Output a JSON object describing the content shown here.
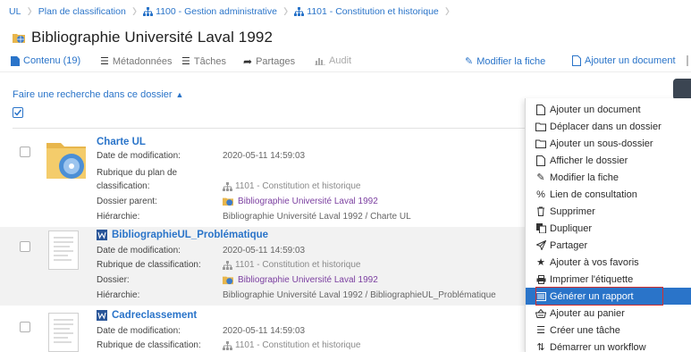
{
  "breadcrumb": {
    "items": [
      {
        "label": "UL"
      },
      {
        "label": "Plan de classification"
      },
      {
        "label": "1100 - Gestion administrative",
        "icon": "tree-icon"
      },
      {
        "label": "1101 - Constitution et historique",
        "icon": "tree-icon"
      }
    ]
  },
  "page": {
    "title": "Bibliographie Université Laval 1992",
    "title_icon": "folder-globe-icon"
  },
  "tabs": [
    {
      "label": "Contenu (19)",
      "icon": "file-icon",
      "state": "active"
    },
    {
      "label": "Métadonnées",
      "icon": "list-icon",
      "state": "normal"
    },
    {
      "label": "Tâches",
      "icon": "tasks-icon",
      "state": "normal"
    },
    {
      "label": "Partages",
      "icon": "share-icon",
      "state": "normal"
    },
    {
      "label": "Audit",
      "icon": "chart-icon",
      "state": "disabled"
    }
  ],
  "actions": {
    "edit": "Modifier la fiche",
    "add_document": "Ajouter un document"
  },
  "search": {
    "toggle_label": "Faire une recherche dans ce dossier"
  },
  "rows": [
    {
      "title": "Charte UL",
      "kind": "folder",
      "fields": [
        {
          "label": "Date de modification:",
          "value": "2020-05-11 14:59:03"
        },
        {
          "label": "Rubrique du plan de",
          "value": ""
        },
        {
          "label": "classification:",
          "value": "1101 - Constitution et historique"
        },
        {
          "label": "Dossier parent:",
          "value": "Bibliographie Université Laval 1992"
        },
        {
          "label": "Hiérarchie:",
          "value": "Bibliographie Université Laval 1992 / Charte UL"
        }
      ]
    },
    {
      "title": "BibliographieUL_Problématique",
      "kind": "document",
      "fields": [
        {
          "label": "Date de modification:",
          "value": "2020-05-11 14:59:03"
        },
        {
          "label": "Rubrique de classification:",
          "value": "1101 - Constitution et historique"
        },
        {
          "label": "Dossier:",
          "value": "Bibliographie Université Laval 1992"
        },
        {
          "label": "Hiérarchie:",
          "value": "Bibliographie Université Laval 1992 / BibliographieUL_Problématique"
        }
      ]
    },
    {
      "title": "Cadreclassement",
      "kind": "document",
      "fields": [
        {
          "label": "Date de modification:",
          "value": "2020-05-11 14:59:03"
        },
        {
          "label": "Rubrique de classification:",
          "value": "1101 - Constitution et historique"
        }
      ]
    }
  ],
  "context_menu": {
    "items": [
      {
        "label": "Ajouter un document",
        "icon": "file-icon"
      },
      {
        "label": "Déplacer dans un dossier",
        "icon": "folder-icon"
      },
      {
        "label": "Ajouter un sous-dossier",
        "icon": "folder-icon"
      },
      {
        "label": "Afficher le dossier",
        "icon": "file-icon"
      },
      {
        "label": "Modifier la fiche",
        "icon": "edit-icon"
      },
      {
        "label": "Lien de consultation",
        "icon": "link-icon"
      },
      {
        "label": "Supprimer",
        "icon": "trash-icon"
      },
      {
        "label": "Dupliquer",
        "icon": "copy-icon"
      },
      {
        "label": "Partager",
        "icon": "send-icon"
      },
      {
        "label": "Ajouter à vos favoris",
        "icon": "star-icon"
      },
      {
        "label": "Imprimer l'étiquette",
        "icon": "print-icon"
      },
      {
        "label": "Générer un rapport",
        "icon": "report-icon",
        "state": "highlighted"
      },
      {
        "label": "Ajouter au panier",
        "icon": "basket-icon"
      },
      {
        "label": "Créer une tâche",
        "icon": "tasks-icon"
      },
      {
        "label": "Démarrer un workflow",
        "icon": "workflow-icon"
      }
    ]
  },
  "colors": {
    "accent": "#2a74c9",
    "purple_link": "#7b3fa0",
    "highlight_outline": "#d32f2f"
  }
}
